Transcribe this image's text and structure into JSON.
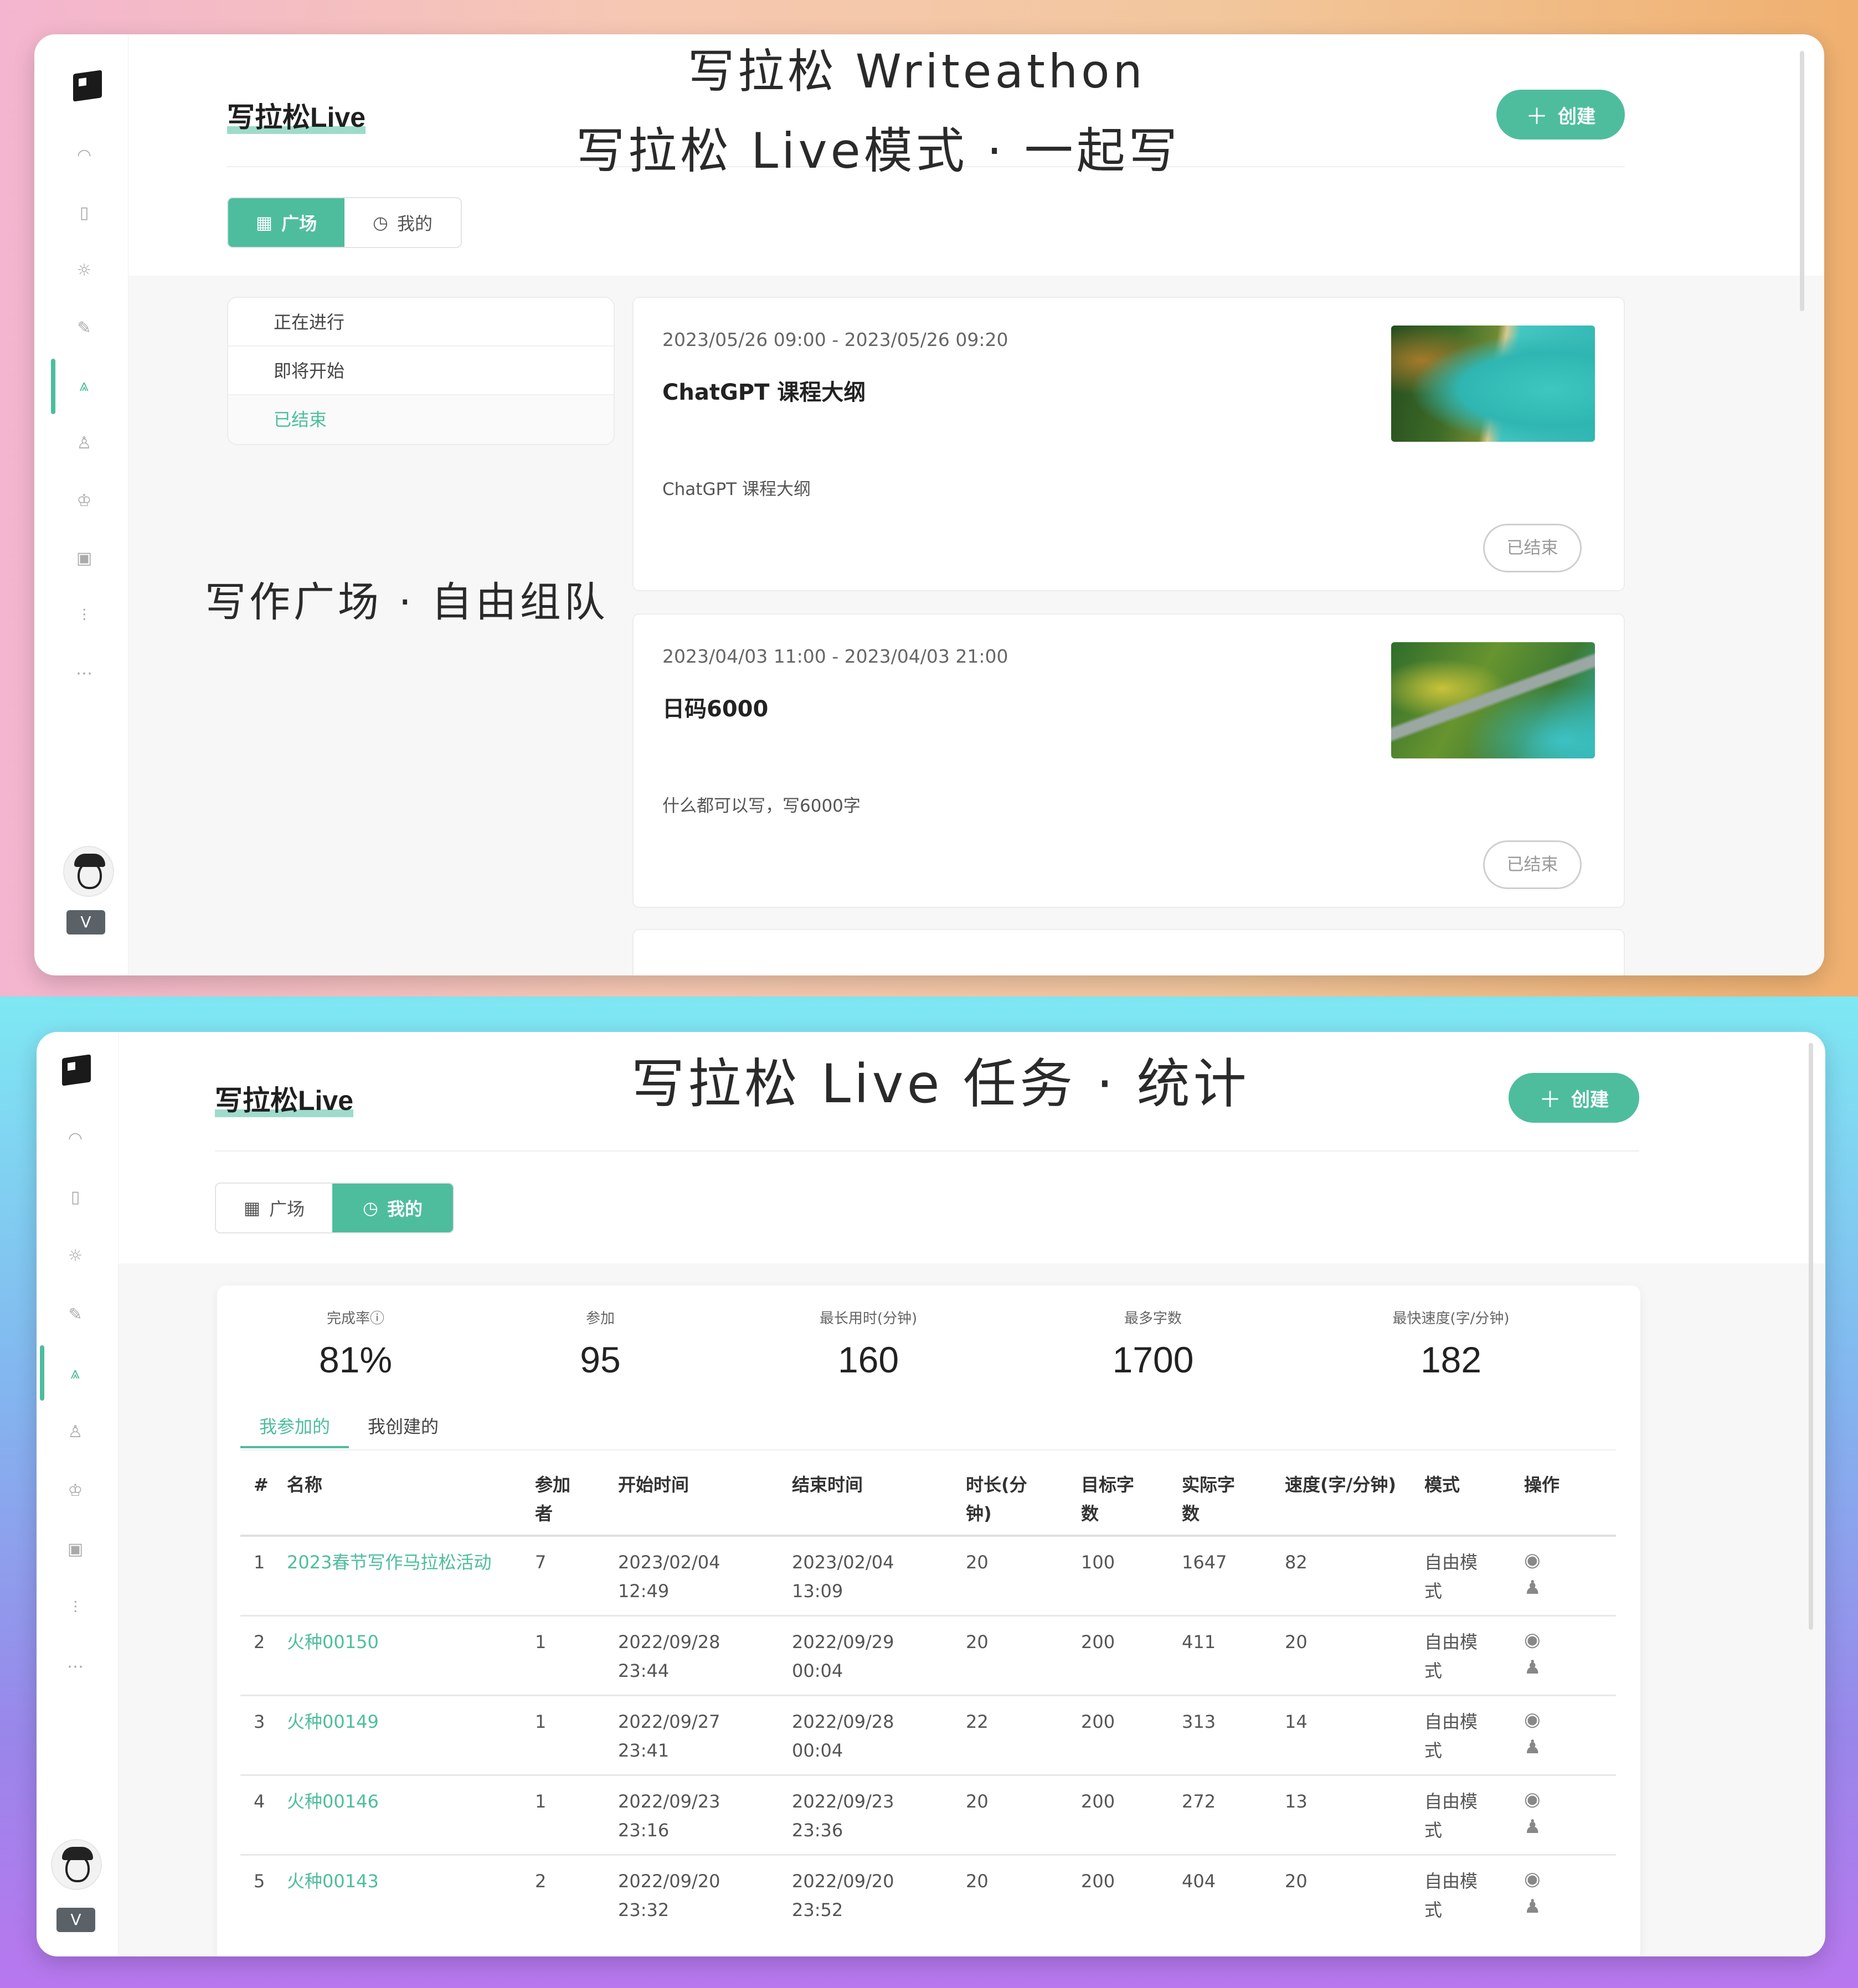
{
  "screens": {
    "top": {
      "app_title": "写拉松Live",
      "create_button": {
        "icon": "plus-icon",
        "label": "创建"
      },
      "tabs": [
        {
          "label": "广场",
          "icon": "grid-icon",
          "active": true
        },
        {
          "label": "我的",
          "icon": "clock-icon",
          "active": false
        }
      ],
      "filters": [
        {
          "label": "正在进行",
          "selected": false
        },
        {
          "label": "即将开始",
          "selected": false
        },
        {
          "label": "已结束",
          "selected": true
        }
      ],
      "events": [
        {
          "time": "2023/05/26 09:00 - 2023/05/26 09:20",
          "title": "ChatGPT 课程大纲",
          "description": "ChatGPT 课程大纲",
          "status": "已结束",
          "thumbnail": "coast-forest-image"
        },
        {
          "time": "2023/04/03 11:00 - 2023/04/03 21:00",
          "title": "日码6000",
          "description": "什么都可以写，写6000字",
          "status": "已结束",
          "thumbnail": "road-forest-image"
        }
      ]
    },
    "bottom": {
      "app_title": "写拉松Live",
      "create_button": {
        "icon": "plus-icon",
        "label": "创建"
      },
      "tabs": [
        {
          "label": "广场",
          "icon": "grid-icon",
          "active": false
        },
        {
          "label": "我的",
          "icon": "clock-icon",
          "active": true
        }
      ],
      "stats": [
        {
          "label": "完成率ⓘ",
          "value": "81%"
        },
        {
          "label": "参加",
          "value": "95"
        },
        {
          "label": "最长用时(分钟)",
          "value": "160"
        },
        {
          "label": "最多字数",
          "value": "1700"
        },
        {
          "label": "最快速度(字/分钟)",
          "value": "182"
        }
      ],
      "subtabs": [
        {
          "label": "我参加的",
          "active": true
        },
        {
          "label": "我创建的",
          "active": false
        }
      ],
      "table": {
        "columns": [
          "#",
          "名称",
          "参加者",
          "开始时间",
          "结束时间",
          "时长(分钟)",
          "目标字数",
          "实际字数",
          "速度(字/分钟)",
          "模式",
          "操作"
        ],
        "rows": [
          {
            "idx": "1",
            "name": "2023春节写作马拉松活动",
            "participants": "7",
            "start": "2023/02/04 12:49",
            "end": "2023/02/04 13:09",
            "duration": "20",
            "target": "100",
            "actual": "1647",
            "speed": "82",
            "mode": "自由模式"
          },
          {
            "idx": "2",
            "name": "火种00150",
            "participants": "1",
            "start": "2022/09/28 23:44",
            "end": "2022/09/29 00:04",
            "duration": "20",
            "target": "200",
            "actual": "411",
            "speed": "20",
            "mode": "自由模式"
          },
          {
            "idx": "3",
            "name": "火种00149",
            "participants": "1",
            "start": "2022/09/27 23:41",
            "end": "2022/09/28 00:04",
            "duration": "22",
            "target": "200",
            "actual": "313",
            "speed": "14",
            "mode": "自由模式"
          },
          {
            "idx": "4",
            "name": "火种00146",
            "participants": "1",
            "start": "2022/09/23 23:16",
            "end": "2022/09/23 23:36",
            "duration": "20",
            "target": "200",
            "actual": "272",
            "speed": "13",
            "mode": "自由模式"
          },
          {
            "idx": "5",
            "name": "火种00143",
            "participants": "2",
            "start": "2022/09/20 23:32",
            "end": "2022/09/20 23:52",
            "duration": "20",
            "target": "200",
            "actual": "404",
            "speed": "20",
            "mode": "自由模式"
          }
        ],
        "row_actions": [
          "eye-icon",
          "users-icon"
        ]
      }
    }
  },
  "annotations": {
    "line1": "写拉松 Writeathon",
    "line2": "写拉松 Live模式 · 一起写",
    "line3": "写作广场 · 自由组队",
    "line4": "写拉松 Live 任务 · 统计"
  },
  "sidebar": {
    "icons": [
      "logo-icon",
      "dashboard-icon",
      "map-icon",
      "sun-icon",
      "pencil-icon",
      "people-icon",
      "hand-icon",
      "trophy-icon",
      "calendar-icon",
      "settings-icon",
      "more-icon"
    ],
    "active": "people-icon",
    "badge": "V"
  },
  "colors": {
    "accent": "#4ebd9e",
    "text": "#333333",
    "muted": "#999999"
  }
}
